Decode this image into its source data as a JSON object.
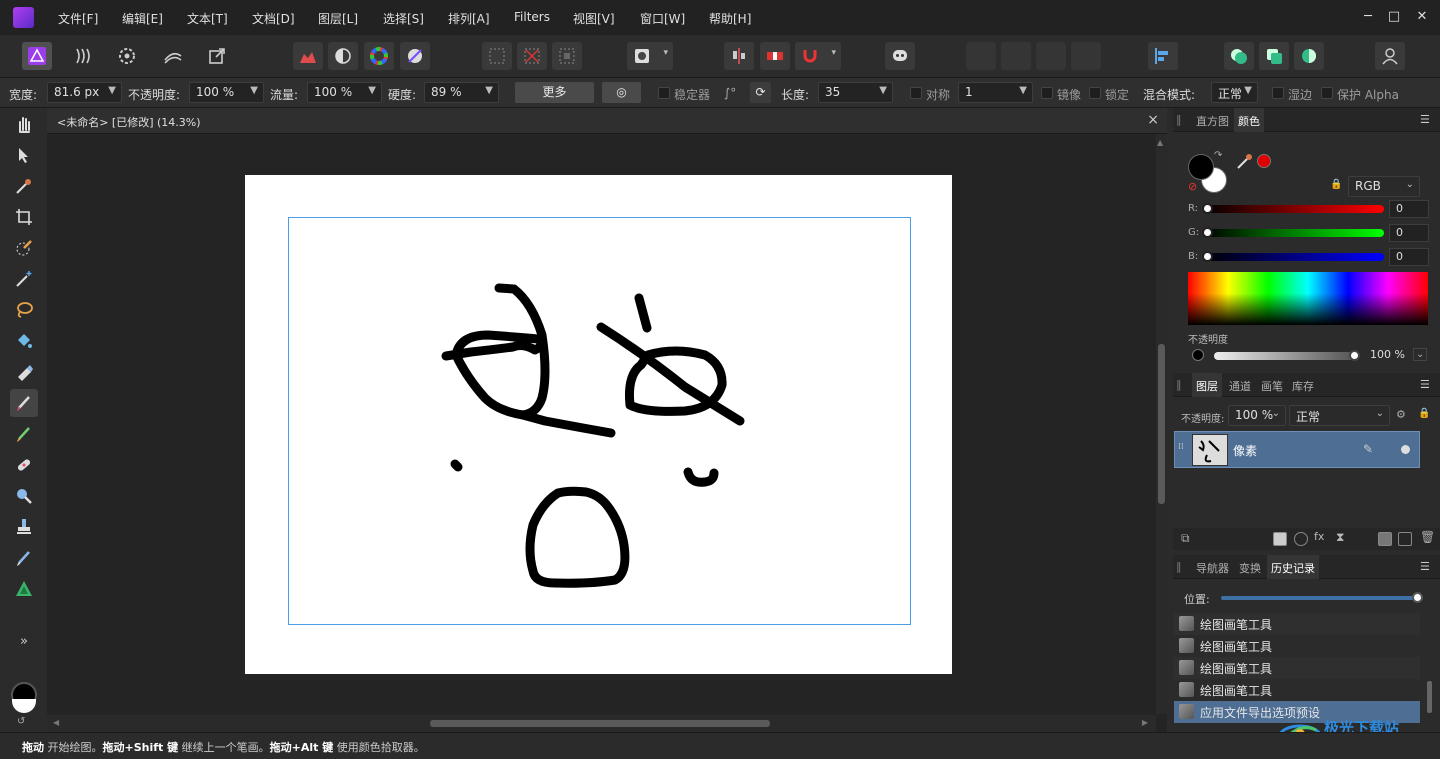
{
  "menu": [
    "文件[F]",
    "编辑[E]",
    "文本[T]",
    "文档[D]",
    "图层[L]",
    "选择[S]",
    "排列[A]",
    "Filters",
    "视图[V]",
    "窗口[W]",
    "帮助[H]"
  ],
  "window": {
    "minimize": "─",
    "maximize": "□",
    "close": "✕"
  },
  "context_toolbar": {
    "width_label": "宽度:",
    "width_value": "81.6 px",
    "opacity_label": "不透明度:",
    "opacity_value": "100 %",
    "flow_label": "流量:",
    "flow_value": "100 %",
    "hardness_label": "硬度:",
    "hardness_value": "89 %",
    "more_button": "更多",
    "stabilizer_label": "稳定器",
    "length_label": "长度:",
    "length_value": "35",
    "symmetry_label": "对称",
    "symmetry_value": "1",
    "mirror_label": "镜像",
    "lock_label": "锁定",
    "blend_label": "混合模式:",
    "blend_value": "正常",
    "wet_edges_label": "湿边",
    "protect_alpha_label": "保护 Alpha"
  },
  "document": {
    "tab_title": "<未命名> [已修改] (14.3%)",
    "close": "×"
  },
  "status": {
    "b1": "拖动",
    "t1": " 开始绘图。",
    "b2": "拖动+Shift 键",
    "t2": " 继续上一个笔画。",
    "b3": "拖动+Alt 键",
    "t3": " 使用颜色拾取器。"
  },
  "color_panel": {
    "tabs": [
      "直方图",
      "颜色"
    ],
    "active_tab": "颜色",
    "mode": "RGB",
    "r_label": "R:",
    "g_label": "G:",
    "b_label": "B:",
    "r_value": "0",
    "g_value": "0",
    "b_value": "0",
    "opacity_label": "不透明度",
    "opacity_value": "100 %",
    "primary_color": "#000000",
    "secondary_color": "#ffffff",
    "picked_color": "#e00000"
  },
  "layers_panel": {
    "tabs": [
      "图层",
      "通道",
      "画笔",
      "库存"
    ],
    "active_tab": "图层",
    "opacity_label": "不透明度:",
    "opacity_value": "100 %",
    "blend_value": "正常",
    "layer_name": "像素"
  },
  "history_panel": {
    "tabs": [
      "导航器",
      "变换",
      "历史记录"
    ],
    "active_tab": "历史记录",
    "position_label": "位置:",
    "position_value": 0.98,
    "items": [
      "绘图画笔工具",
      "绘图画笔工具",
      "绘图画笔工具",
      "绘图画笔工具",
      "应用文件导出选项预设"
    ],
    "selected_index": 4
  },
  "watermark": "极光下载站",
  "colors": {
    "accent": "#4a9ee6",
    "selection": "#4e6e93",
    "brand": "#9b3de8"
  }
}
